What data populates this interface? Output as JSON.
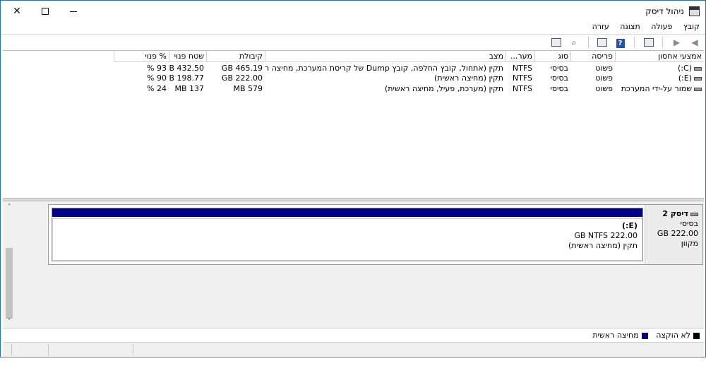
{
  "window": {
    "title": "ניהול דיסק"
  },
  "menubar": [
    "קובץ",
    "פעולה",
    "תצוגה",
    "עזרה"
  ],
  "columns": [
    "אמצעי אחסון",
    "פריסה",
    "סוג",
    "מער...",
    "מצב",
    "קיבולת",
    "שטח פנוי",
    "% פנוי"
  ],
  "volumes": [
    {
      "name": "(C:)",
      "layout": "פשוט",
      "type": "בסיסי",
      "fs": "NTFS",
      "status": "תקין (אתחול, קובץ החלפה, קובץ Dump של קריסת המערכת, מחיצה ראשית)",
      "capacity": "465.19 GB",
      "free": "432.50 GB",
      "pct": "93 %"
    },
    {
      "name": "(E:)",
      "layout": "פשוט",
      "type": "בסיסי",
      "fs": "NTFS",
      "status": "תקין (מחיצה ראשית)",
      "capacity": "222.00 GB",
      "free": "198.77 GB",
      "pct": "90 %"
    },
    {
      "name": "שמור על-ידי המערכת",
      "layout": "פשוט",
      "type": "בסיסי",
      "fs": "NTFS",
      "status": "תקין (מערכת, פעיל, מחיצה ראשית)",
      "capacity": "579 MB",
      "free": "137 MB",
      "pct": "24 %"
    }
  ],
  "disk": {
    "name": "דיסק 2",
    "type": "בסיסי",
    "size": "222.00 GB",
    "state": "מקוון",
    "partition": {
      "name": "(E:)",
      "size_fs": "222.00 GB NTFS",
      "status": "תקין (מחיצה ראשית)"
    }
  },
  "legend": [
    {
      "label": "לא הוקצה",
      "color": "#000000"
    },
    {
      "label": "מחיצה ראשית",
      "color": "#00008b"
    }
  ]
}
